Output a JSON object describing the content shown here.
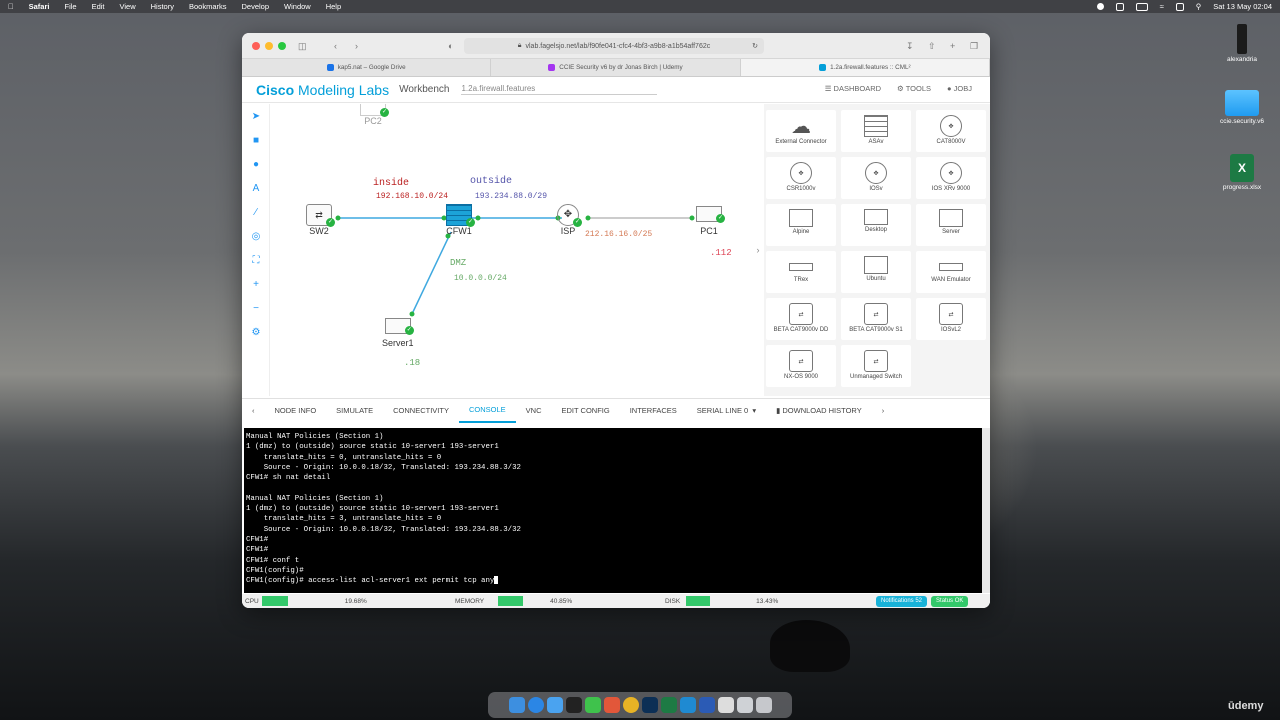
{
  "menubar": {
    "apple": "",
    "items": [
      "Safari",
      "File",
      "Edit",
      "View",
      "History",
      "Bookmarks",
      "Develop",
      "Window",
      "Help"
    ],
    "clock": "Sat 13 May 02:04"
  },
  "desktop": {
    "icons": [
      {
        "label": "alexandria",
        "type": "device"
      },
      {
        "label": "ccie.security.v6",
        "type": "folder"
      },
      {
        "label": "progress.xlsx",
        "type": "excel"
      }
    ]
  },
  "browser": {
    "url": "vlab.fagelsjo.net/lab/f90fe041-cfc4-4bf3-a9b8-a1b54aff762c",
    "tabs": [
      {
        "label": "kap5.nat – Google Drive",
        "color": "#1a73e8"
      },
      {
        "label": "CCIE Security v6 by dr Jonas Birch | Udemy",
        "color": "#a435f0"
      },
      {
        "label": "1.2a.firewall.features :: CML²",
        "color": "#049fd9"
      }
    ],
    "active_tab": 2
  },
  "app": {
    "brand_bold": "Cisco",
    "brand_rest": " Modeling Labs",
    "workbench": "Workbench",
    "lab_name": "1.2a.firewall.features",
    "dashboard": "DASHBOARD",
    "tools": "TOOLS",
    "user": "JOBJ"
  },
  "topology": {
    "nodes": {
      "pc2": "PC2",
      "sw2": "SW2",
      "cfw1": "CFW1",
      "isp": "ISP",
      "pc1": "PC1",
      "server1": "Server1"
    },
    "labels": {
      "inside": "inside",
      "inside_net": "192.168.10.0/24",
      "outside": "outside",
      "outside_net": "193.234.88.0/29",
      "isp_net": "212.16.16.0/25",
      "pc1_host": ".112",
      "dmz": "DMZ",
      "dmz_net": "10.0.0.0/24",
      "server_host": ".18"
    }
  },
  "palette": [
    {
      "label": "External Connector",
      "icon": "cloud-icon"
    },
    {
      "label": "ASAv",
      "icon": "firewall-icon"
    },
    {
      "label": "CAT8000V",
      "icon": "router-icon"
    },
    {
      "label": "CSR1000v",
      "icon": "router-icon"
    },
    {
      "label": "IOSv",
      "icon": "router-icon"
    },
    {
      "label": "IOS XRv 9000",
      "icon": "router-icon"
    },
    {
      "label": "Alpine",
      "icon": "server-icon"
    },
    {
      "label": "Desktop",
      "icon": "desktop-icon"
    },
    {
      "label": "Server",
      "icon": "server-icon"
    },
    {
      "label": "TRex",
      "icon": "appliance-icon"
    },
    {
      "label": "Ubuntu",
      "icon": "server-icon"
    },
    {
      "label": "WAN Emulator",
      "icon": "appliance-icon"
    },
    {
      "label": "BETA CAT9000v DD",
      "icon": "switch-icon"
    },
    {
      "label": "BETA CAT9000v S1",
      "icon": "switch-icon"
    },
    {
      "label": "IOSvL2",
      "icon": "switch-icon"
    },
    {
      "label": "NX-OS 9000",
      "icon": "switch-icon"
    },
    {
      "label": "Unmanaged Switch",
      "icon": "switch-icon"
    }
  ],
  "bottom_tabs": {
    "items": [
      "NODE INFO",
      "SIMULATE",
      "CONNECTIVITY",
      "CONSOLE",
      "VNC",
      "EDIT CONFIG",
      "INTERFACES"
    ],
    "active": "CONSOLE",
    "serial": "SERIAL LINE 0",
    "download": "DOWNLOAD HISTORY"
  },
  "console": {
    "lines": [
      "Manual NAT Policies (Section 1)",
      "1 (dmz) to (outside) source static 10-server1 193-server1",
      "    translate_hits = 0, untranslate_hits = 0",
      "    Source - Origin: 10.0.0.18/32, Translated: 193.234.88.3/32",
      "CFW1# sh nat detail",
      "",
      "Manual NAT Policies (Section 1)",
      "1 (dmz) to (outside) source static 10-server1 193-server1",
      "    translate_hits = 3, untranslate_hits = 0",
      "    Source - Origin: 10.0.0.18/32, Translated: 193.234.88.3/32",
      "CFW1#",
      "CFW1#",
      "CFW1# conf t",
      "CFW1(config)#",
      "CFW1(config)# access-list acl-server1 ext permit tcp any"
    ]
  },
  "statusbar": {
    "cpu_label": "CPU",
    "cpu_value": "19.68%",
    "cpu_fraction": 0.1968,
    "memory_label": "MEMORY",
    "memory_value": "40.85%",
    "memory_fraction": 0.4085,
    "disk_label": "DISK",
    "disk_value": "13.43%",
    "disk_fraction": 0.1343,
    "notifications": "Notifications 52",
    "status_ok": "Status OK"
  }
}
